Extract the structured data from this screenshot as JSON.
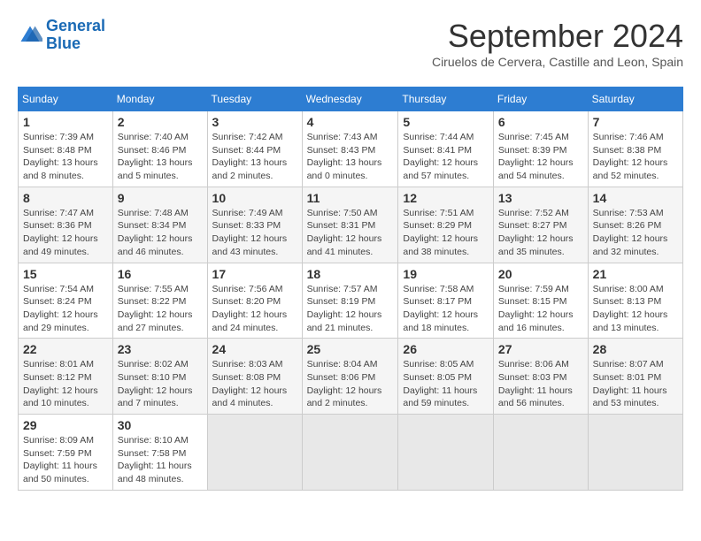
{
  "header": {
    "logo_line1": "General",
    "logo_line2": "Blue",
    "title": "September 2024",
    "subtitle": "Ciruelos de Cervera, Castille and Leon, Spain"
  },
  "weekdays": [
    "Sunday",
    "Monday",
    "Tuesday",
    "Wednesday",
    "Thursday",
    "Friday",
    "Saturday"
  ],
  "weeks": [
    [
      {
        "day": "1",
        "sunrise": "7:39 AM",
        "sunset": "8:48 PM",
        "daylight": "13 hours and 8 minutes."
      },
      {
        "day": "2",
        "sunrise": "7:40 AM",
        "sunset": "8:46 PM",
        "daylight": "13 hours and 5 minutes."
      },
      {
        "day": "3",
        "sunrise": "7:42 AM",
        "sunset": "8:44 PM",
        "daylight": "13 hours and 2 minutes."
      },
      {
        "day": "4",
        "sunrise": "7:43 AM",
        "sunset": "8:43 PM",
        "daylight": "13 hours and 0 minutes."
      },
      {
        "day": "5",
        "sunrise": "7:44 AM",
        "sunset": "8:41 PM",
        "daylight": "12 hours and 57 minutes."
      },
      {
        "day": "6",
        "sunrise": "7:45 AM",
        "sunset": "8:39 PM",
        "daylight": "12 hours and 54 minutes."
      },
      {
        "day": "7",
        "sunrise": "7:46 AM",
        "sunset": "8:38 PM",
        "daylight": "12 hours and 52 minutes."
      }
    ],
    [
      {
        "day": "8",
        "sunrise": "7:47 AM",
        "sunset": "8:36 PM",
        "daylight": "12 hours and 49 minutes."
      },
      {
        "day": "9",
        "sunrise": "7:48 AM",
        "sunset": "8:34 PM",
        "daylight": "12 hours and 46 minutes."
      },
      {
        "day": "10",
        "sunrise": "7:49 AM",
        "sunset": "8:33 PM",
        "daylight": "12 hours and 43 minutes."
      },
      {
        "day": "11",
        "sunrise": "7:50 AM",
        "sunset": "8:31 PM",
        "daylight": "12 hours and 41 minutes."
      },
      {
        "day": "12",
        "sunrise": "7:51 AM",
        "sunset": "8:29 PM",
        "daylight": "12 hours and 38 minutes."
      },
      {
        "day": "13",
        "sunrise": "7:52 AM",
        "sunset": "8:27 PM",
        "daylight": "12 hours and 35 minutes."
      },
      {
        "day": "14",
        "sunrise": "7:53 AM",
        "sunset": "8:26 PM",
        "daylight": "12 hours and 32 minutes."
      }
    ],
    [
      {
        "day": "15",
        "sunrise": "7:54 AM",
        "sunset": "8:24 PM",
        "daylight": "12 hours and 29 minutes."
      },
      {
        "day": "16",
        "sunrise": "7:55 AM",
        "sunset": "8:22 PM",
        "daylight": "12 hours and 27 minutes."
      },
      {
        "day": "17",
        "sunrise": "7:56 AM",
        "sunset": "8:20 PM",
        "daylight": "12 hours and 24 minutes."
      },
      {
        "day": "18",
        "sunrise": "7:57 AM",
        "sunset": "8:19 PM",
        "daylight": "12 hours and 21 minutes."
      },
      {
        "day": "19",
        "sunrise": "7:58 AM",
        "sunset": "8:17 PM",
        "daylight": "12 hours and 18 minutes."
      },
      {
        "day": "20",
        "sunrise": "7:59 AM",
        "sunset": "8:15 PM",
        "daylight": "12 hours and 16 minutes."
      },
      {
        "day": "21",
        "sunrise": "8:00 AM",
        "sunset": "8:13 PM",
        "daylight": "12 hours and 13 minutes."
      }
    ],
    [
      {
        "day": "22",
        "sunrise": "8:01 AM",
        "sunset": "8:12 PM",
        "daylight": "12 hours and 10 minutes."
      },
      {
        "day": "23",
        "sunrise": "8:02 AM",
        "sunset": "8:10 PM",
        "daylight": "12 hours and 7 minutes."
      },
      {
        "day": "24",
        "sunrise": "8:03 AM",
        "sunset": "8:08 PM",
        "daylight": "12 hours and 4 minutes."
      },
      {
        "day": "25",
        "sunrise": "8:04 AM",
        "sunset": "8:06 PM",
        "daylight": "12 hours and 2 minutes."
      },
      {
        "day": "26",
        "sunrise": "8:05 AM",
        "sunset": "8:05 PM",
        "daylight": "11 hours and 59 minutes."
      },
      {
        "day": "27",
        "sunrise": "8:06 AM",
        "sunset": "8:03 PM",
        "daylight": "11 hours and 56 minutes."
      },
      {
        "day": "28",
        "sunrise": "8:07 AM",
        "sunset": "8:01 PM",
        "daylight": "11 hours and 53 minutes."
      }
    ],
    [
      {
        "day": "29",
        "sunrise": "8:09 AM",
        "sunset": "7:59 PM",
        "daylight": "11 hours and 50 minutes."
      },
      {
        "day": "30",
        "sunrise": "8:10 AM",
        "sunset": "7:58 PM",
        "daylight": "11 hours and 48 minutes."
      },
      null,
      null,
      null,
      null,
      null
    ]
  ]
}
